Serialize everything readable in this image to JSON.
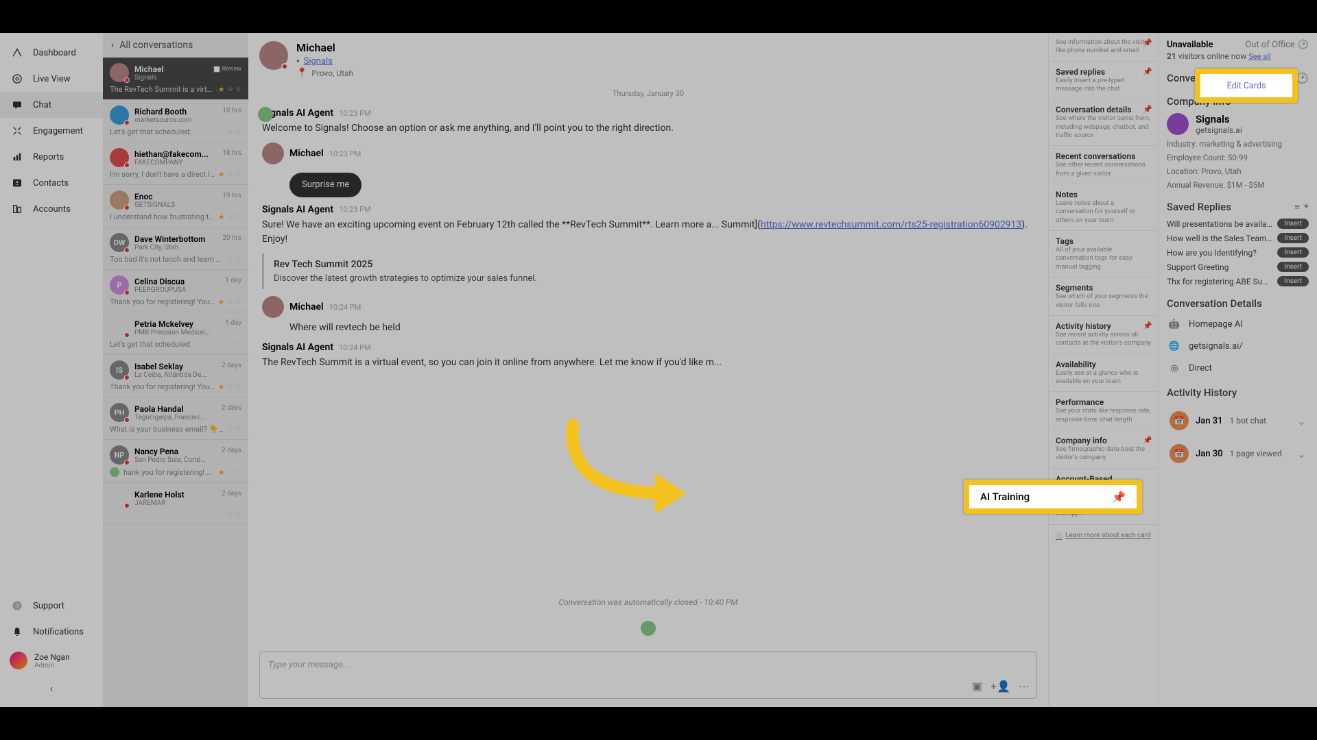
{
  "leftNav": {
    "items": [
      {
        "label": "Dashboard"
      },
      {
        "label": "Live View"
      },
      {
        "label": "Chat"
      },
      {
        "label": "Engagement"
      },
      {
        "label": "Reports"
      },
      {
        "label": "Contacts"
      },
      {
        "label": "Accounts"
      }
    ],
    "bottom": [
      {
        "label": "Support"
      },
      {
        "label": "Notifications"
      }
    ],
    "user": {
      "name": "Zoe Ngan",
      "role": "Admin"
    }
  },
  "convList": {
    "header": "All conversations",
    "items": [
      {
        "name": "Michael",
        "sub": "Signals",
        "preview": "The RevTech Summit is a virtual...",
        "time": "",
        "review": "Review",
        "active": true,
        "starOn": true,
        "av": ""
      },
      {
        "name": "Richard Booth",
        "sub": "marketsource.com",
        "preview": "Let's get that scheduled:",
        "time": "18 hrs",
        "av": "",
        "avbg": "#3aa0e0"
      },
      {
        "name": "hiethan@fakecom...",
        "sub": "FAKECOMPANY",
        "preview": "I'm sorry, I don't have a direct li...",
        "time": "18 hrs",
        "starOn": true,
        "av": "",
        "avbg": "#e05050"
      },
      {
        "name": "Enoc",
        "sub": "GETSIGNALS",
        "preview": "I understand how frustrating thi...",
        "time": "19 hrs",
        "starOn": true,
        "av": "",
        "avbg": "#d0a080"
      },
      {
        "name": "Dave Winterbottom",
        "sub": "Park City, Utah",
        "preview": "Too bad it's not lunch and learn pizza d...",
        "time": "20 hrs",
        "av": "DW",
        "avbg": "#888"
      },
      {
        "name": "Celina Discua",
        "sub": "PEERGROUPUSA",
        "preview": "Thank you for registering! You ...",
        "time": "1 day",
        "starOn": true,
        "av": "P",
        "avbg": "#d090e0"
      },
      {
        "name": "Petria Mckelvey",
        "sub": "PMB Precision Medical...",
        "preview": "Let's get that scheduled:",
        "time": "1 day",
        "av": "",
        "avbg": "#eee"
      },
      {
        "name": "Isabel Seklay",
        "sub": "La Ceiba, Atlántida De...",
        "preview": "Thank you for registering! You ...",
        "time": "2 days",
        "starOn": true,
        "av": "IS",
        "avbg": "#888"
      },
      {
        "name": "Paola Handal",
        "sub": "Tegucigalpa, Francisc...",
        "preview": "What is your business email? 👇 (this is...",
        "time": "2 days",
        "av": "PH",
        "avbg": "#888"
      },
      {
        "name": "Nancy Pena",
        "sub": "San Pedro Sula, Corté...",
        "preview": "hank you for registering! You ...",
        "time": "2 days",
        "starOn": true,
        "av": "NP",
        "avbg": "#888",
        "botIcon": true
      },
      {
        "name": "Karlene Holst",
        "sub": "JAREMAR",
        "preview": "",
        "time": "2 days",
        "av": "",
        "avbg": "#eee"
      }
    ]
  },
  "chat": {
    "name": "Michael",
    "link": "Signals",
    "location": "Provo, Utah",
    "dateDivider": "Thursday, January 30",
    "messages": [
      {
        "who": "Signals AI Agent",
        "time": "10:23 PM",
        "body": "Welcome to Signals! Choose an option or ask me anything, and I'll point you to the right direction.",
        "bot": true
      },
      {
        "who": "Michael",
        "time": "10:23 PM",
        "body": "",
        "button": "Surprise me"
      },
      {
        "who": "Signals AI Agent",
        "time": "10:23 PM",
        "body_pre": "Sure! We have an exciting upcoming event on February 12th called the **RevTech Summit**. Learn more a... Summit](",
        "body_link": "https://www.revtechsummit.com/rts25-registration60902913",
        "body_post": "). Enjoy!",
        "card_title": "Rev Tech Summit 2025",
        "card_sub": "Discover the latest growth strategies to optimize your sales funnel.",
        "bot": true
      },
      {
        "who": "Michael",
        "time": "10:24 PM",
        "body": "Where will revtech be held"
      },
      {
        "who": "Signals AI Agent",
        "time": "10:24 PM",
        "body": "The RevTech Summit is a virtual event, so you can join it online from anywhere. Let me know if you'd like m...",
        "bot": true
      }
    ],
    "closed": "Conversation was automatically closed - 10:40 PM",
    "inputPlaceholder": "Type your message..."
  },
  "cards": [
    {
      "title": "",
      "desc": "See information about the visitor, like phone number and email",
      "pin": true
    },
    {
      "title": "Saved replies",
      "desc": "Easily insert a pre-typed message into the chat",
      "pin": true
    },
    {
      "title": "Conversation details",
      "desc": "See where the visitor came from, including webpage, chatbot, and traffic source",
      "pin": true
    },
    {
      "title": "Recent conversations",
      "desc": "See other recent conversations from a given visitor"
    },
    {
      "title": "Notes",
      "desc": "Leave notes about a conversation for yourself or others on your team"
    },
    {
      "title": "Tags",
      "desc": "All of your available conversation tags for easy manual tagging"
    },
    {
      "title": "Segments",
      "desc": "See which of your segments the visitor falls into"
    },
    {
      "title": "Activity history",
      "desc": "See recent activity across all contacts at the visitor's company",
      "pin": true
    },
    {
      "title": "Availability",
      "desc": "Easily see at a glance who is available on your team"
    },
    {
      "title": "Performance",
      "desc": "See your stats like response rate, response time, chat length"
    },
    {
      "title": "Company info",
      "desc": "See firmographic data bout the visitor's company",
      "pin": true
    },
    {
      "title": "Account-Based Engagement",
      "desc": "See the visiting account's Signals Score, account owner, and opp..."
    }
  ],
  "cardLearn": "Learn more about each card",
  "rightPanel": {
    "status": "Unavailable",
    "office": "Out of Office",
    "online_count": "21",
    "online_text": "visitors online now",
    "seeAll": "See all",
    "convDetailsHeader": "Conversation Details",
    "editCards": "Edit Cards",
    "companyInfoHeader": "Company Info",
    "company": {
      "name": "Signals",
      "site": "getsignals.ai"
    },
    "details": [
      "Industry: marketing & advertising",
      "Employee Count: 50-99",
      "Location: Provo, Utah",
      "Annual Revenue: $1M - $5M"
    ],
    "savedRepliesHeader": "Saved Replies",
    "replies": [
      "Will presentations be availabl...",
      "How well is the Sales Team e...",
      "How are you Identifying?",
      "Support Greeting",
      "Thx for registering ABE Summit"
    ],
    "insert": "Insert",
    "convDetails2": "Conversation Details",
    "convRows": [
      {
        "icon": "robot",
        "text": "Homepage AI"
      },
      {
        "icon": "globe",
        "text": "getsignals.ai/"
      },
      {
        "icon": "target",
        "text": "Direct"
      }
    ],
    "activityHeader": "Activity History",
    "activity": [
      {
        "date": "Jan 31",
        "text": "1 bot chat"
      },
      {
        "date": "Jan 30",
        "text": "1 page viewed"
      }
    ]
  },
  "highlights": {
    "editCards": "Edit Cards",
    "aiTraining": "AI Training"
  }
}
